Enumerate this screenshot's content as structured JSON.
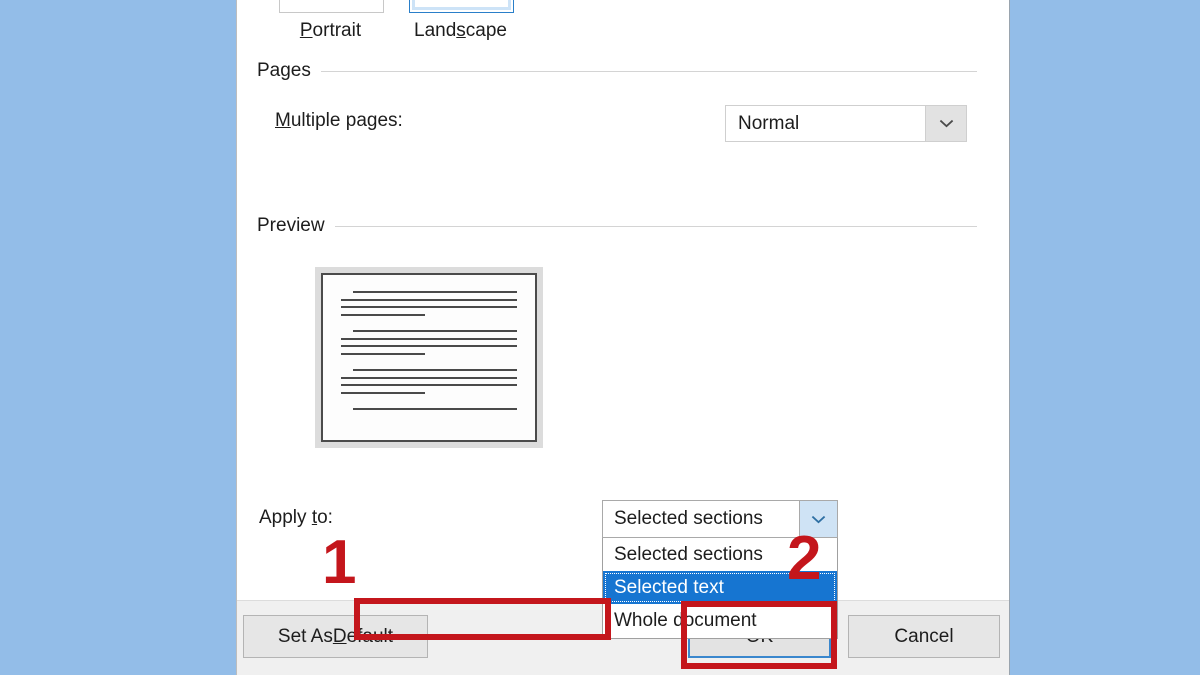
{
  "window": {
    "background_color": "#93bde8",
    "dialog_background": "#ffffff"
  },
  "orientation": {
    "portrait": {
      "label_pre": "P",
      "label_accel": "",
      "label": "Portrait",
      "selected": "false",
      "icon": "portrait-page-icon"
    },
    "landscape": {
      "label": "Landscape",
      "selected": "true",
      "icon": "landscape-page-icon"
    }
  },
  "pages": {
    "group_label": "Pages",
    "multiple_pages_label": "Multiple pages:",
    "multiple_pages_value": "Normal",
    "dropdown_icon": "chevron-down-icon"
  },
  "preview": {
    "group_label": "Preview",
    "page_orientation": "landscape",
    "paragraph_groups": 3,
    "lines_per_group": 4
  },
  "apply_to": {
    "label": "Apply to:",
    "selected_value": "Selected sections",
    "dropdown_open": "true",
    "dropdown_icon": "chevron-down-icon",
    "options": [
      {
        "label": "Selected sections",
        "highlighted": "false"
      },
      {
        "label": "Selected text",
        "highlighted": "true"
      },
      {
        "label": "Whole document",
        "highlighted": "false"
      }
    ],
    "highlight_color": "#1675d1"
  },
  "footer": {
    "set_as_default_label": "Set As Default",
    "ok_label": "OK",
    "cancel_label": "Cancel",
    "ok_focused": "true",
    "focus_color": "#3a87cd"
  },
  "annotations": {
    "color": "#c4161c",
    "step_one": "1",
    "step_two": "2",
    "step_one_target": "selected-text-option",
    "step_two_target": "ok-button"
  }
}
